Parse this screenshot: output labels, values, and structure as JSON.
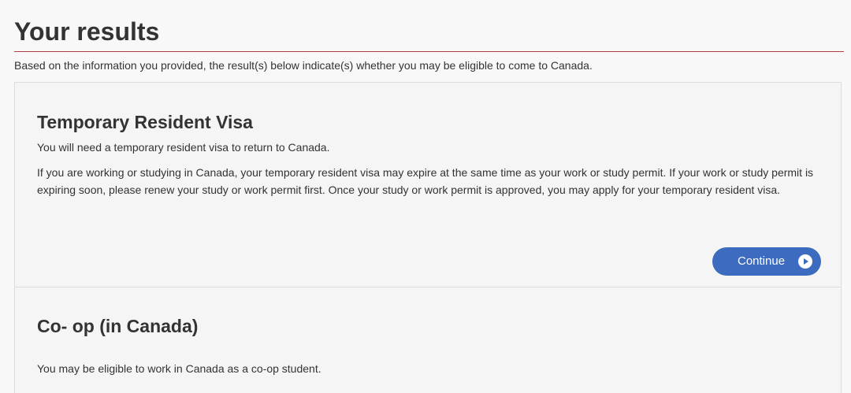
{
  "header": {
    "title": "Your results",
    "intro": "Based on the information you provided, the result(s) below indicate(s) whether you may be eligible to come to Canada."
  },
  "results": [
    {
      "heading": "Temporary Resident Visa",
      "line1": "You will need a temporary resident visa to return to Canada.",
      "paragraph2": "If you are working or studying in Canada, your temporary resident visa may expire at the same time as your work or study permit. If your work or study permit is expiring soon, please renew your study or work permit first. Once your study or work permit is approved, you may apply for your temporary resident visa.",
      "button_label": "Continue",
      "button_icon": "play-circle-icon"
    },
    {
      "heading": "Co- op (in Canada)",
      "line1": "You may be eligible to work in Canada as a co-op student."
    }
  ],
  "colors": {
    "accent_rule": "#af3c43",
    "button": "#3d6bbf",
    "panel_background": "#f5f5f5",
    "panel_border": "#dddddd",
    "text": "#333333"
  }
}
